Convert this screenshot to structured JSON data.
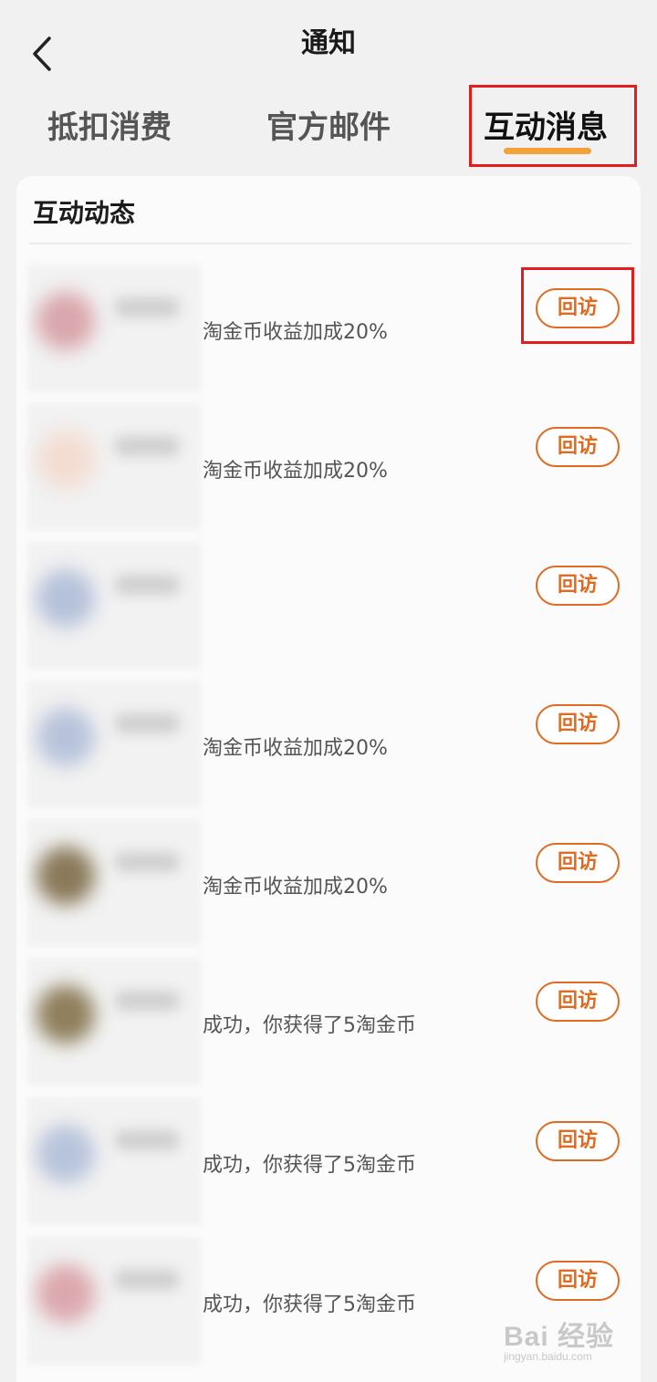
{
  "header": {
    "title": "通知"
  },
  "tabs": [
    {
      "label": "抵扣消费"
    },
    {
      "label": "官方邮件"
    },
    {
      "label": "互动消息"
    }
  ],
  "section": {
    "title": "互动动态"
  },
  "rows": [
    {
      "message": "淘金币收益加成20%",
      "action": "回访",
      "avatar_color": "#d9a7ad"
    },
    {
      "message": "淘金币收益加成20%",
      "action": "回访",
      "avatar_color": "#f3ddd2"
    },
    {
      "message": "",
      "action": "回访",
      "avatar_color": "#b6c2da"
    },
    {
      "message": "淘金币收益加成20%",
      "action": "回访",
      "avatar_color": "#b8c3db"
    },
    {
      "message": "淘金币收益加成20%",
      "action": "回访",
      "avatar_color": "#8a7a5a"
    },
    {
      "message": "成功，你获得了5淘金币",
      "action": "回访",
      "avatar_color": "#8f7f5c"
    },
    {
      "message": "成功，你获得了5淘金币",
      "action": "回访",
      "avatar_color": "#b8c4db"
    },
    {
      "message": "成功，你获得了5淘金币",
      "action": "回访",
      "avatar_color": "#dba8ae"
    }
  ],
  "watermark": {
    "main": "Bai 经验",
    "sub": "jingyan.baidu.com"
  },
  "colors": {
    "accent": "#e06a20",
    "tab_indicator": "#f2a238",
    "highlight": "#e41c1c"
  }
}
